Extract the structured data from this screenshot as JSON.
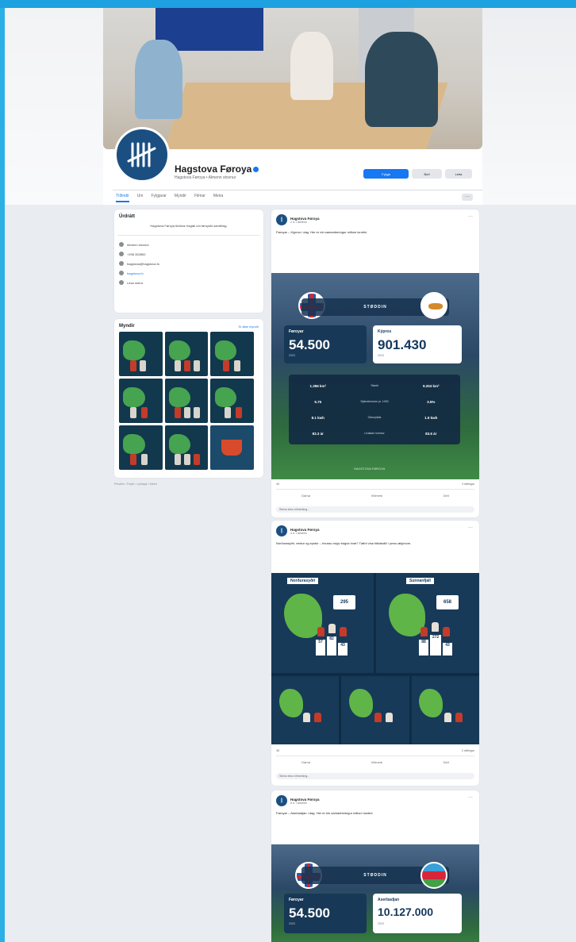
{
  "page": {
    "name": "Hagstova Føroya",
    "subtitle": "Hagstova Føroya • Almenn stovnur",
    "buttons": [
      "Fylgja",
      "Boð",
      "Leita"
    ],
    "tabs": [
      "Tíðindir",
      "Um",
      "Fylgjarar",
      "Myndir",
      "Filmar",
      "Meira"
    ]
  },
  "intro": {
    "title": "Úrdrátt",
    "description": "Hagstova Føroya tilvirkar hagtøl um føroyskt samfelag.",
    "rows": [
      "Almenn stovnur",
      "+298 352800",
      "hagstova@hagstova.fo",
      "hagstova.fo",
      "Lesa meira"
    ]
  },
  "photos": {
    "title": "Myndir",
    "see_all": "Sí allar myndir"
  },
  "footer": "Privatlív • Treytir • Lýsingar • Meira",
  "posts": [
    {
      "author": "Hagstova Føroya",
      "time": "2 d. • Almenn",
      "text": "Føroyar – Kýpros í dag. Her er ein samanberingur millum londini.",
      "stats": {
        "header": "STØDDIN",
        "left": {
          "country": "Føroyar",
          "value": "54.500",
          "year": "2023"
        },
        "right": {
          "country": "Kýpros",
          "value": "901.430",
          "year": "2023"
        },
        "rows": [
          {
            "l": "1.396 km²",
            "m": "Stødd",
            "r": "9.253 km²"
          },
          {
            "l": "5.75",
            "m": "Sjúkrahúsrúm pr. 1000",
            "r": "3.5%"
          },
          {
            "l": "8.1 kwh",
            "m": "Orkunýtsla",
            "r": "1.9 kwh"
          },
          {
            "l": "83.3 ár",
            "m": "Livialdur kvinnur",
            "r": "83.6 ár"
          }
        ],
        "tag": "HAGSTOVA FØROYA"
      },
      "reactions": {
        "count": "45",
        "comments": "3 deilingar"
      },
      "actions": [
        "Dáma",
        "Viðmerk",
        "Deil"
      ],
      "comment_placeholder": "Skriva eina viðmerking..."
    },
    {
      "author": "Hagstova Føroya",
      "time": "4 d. • Almenn",
      "text": "Norðurasyðri, vestur og eystur – hvussu nógv búgva hvar? Tølini vísa fólkatalið í ymsu økjunum.",
      "maps": {
        "top_left": {
          "title": "Norðurasyðri",
          "number": "295"
        },
        "top_right": {
          "title": "Sunnanfjall",
          "number": "658"
        },
        "podiums_left": [
          "57",
          "82",
          "43"
        ],
        "podiums_right": [
          "88",
          "272",
          "43"
        ]
      },
      "reactions": {
        "count": "38",
        "comments": "2 deilingar"
      },
      "actions": [
        "Dáma",
        "Viðmerk",
        "Deil"
      ],
      "comment_placeholder": "Skriva eina viðmerking..."
    },
    {
      "author": "Hagstova Føroya",
      "time": "6 d. • Almenn",
      "text": "Føroyar – Aserbadjan í dag. Her er ein samanberingur millum londini.",
      "stats": {
        "header": "STØDDIN",
        "left": {
          "country": "Føroyar",
          "value": "54.500",
          "year": "2023"
        },
        "right": {
          "country": "Aserbadjan",
          "value": "10.127.000",
          "year": "2023"
        }
      }
    }
  ]
}
